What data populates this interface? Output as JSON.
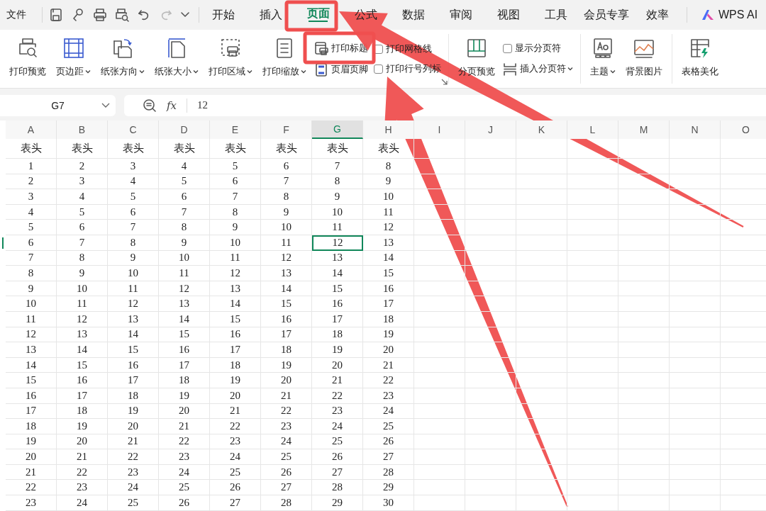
{
  "quick_access": {
    "file_menu": "文件",
    "redo_disabled": true
  },
  "tabs": [
    {
      "label": "开始",
      "selected": false
    },
    {
      "label": "插入",
      "selected": false
    },
    {
      "label": "页面",
      "selected": true
    },
    {
      "label": "公式",
      "selected": false
    },
    {
      "label": "数据",
      "selected": false
    },
    {
      "label": "审阅",
      "selected": false
    },
    {
      "label": "视图",
      "selected": false
    },
    {
      "label": "工具",
      "selected": false
    },
    {
      "label": "会员专享",
      "selected": false
    },
    {
      "label": "效率",
      "selected": false
    }
  ],
  "ai_button": "WPS AI",
  "ribbon": {
    "groups": [
      {
        "launcher": true,
        "columns": [
          [
            {
              "kind": "large",
              "label": "打印预览",
              "dropdown": false
            }
          ],
          [
            {
              "kind": "large",
              "label": "页边距",
              "dropdown": true
            }
          ],
          [
            {
              "kind": "large",
              "label": "纸张方向",
              "dropdown": true
            }
          ],
          [
            {
              "kind": "large",
              "label": "纸张大小",
              "dropdown": true
            }
          ],
          [
            {
              "kind": "large",
              "label": "打印区域",
              "dropdown": true
            }
          ],
          [
            {
              "kind": "large",
              "label": "打印缩放",
              "dropdown": true
            }
          ],
          [
            {
              "kind": "small",
              "label": "打印标题",
              "dropdown": false
            },
            {
              "kind": "small",
              "label": "页眉页脚",
              "dropdown": false
            }
          ],
          [
            {
              "kind": "check",
              "label": "打印网格线",
              "checked": false
            },
            {
              "kind": "check",
              "label": "打印行号列标",
              "checked": false
            }
          ]
        ]
      },
      {
        "launcher": false,
        "columns": [
          [
            {
              "kind": "large",
              "label": "分页预览",
              "dropdown": false
            }
          ],
          [
            {
              "kind": "check",
              "label": "显示分页符",
              "checked": false
            },
            {
              "kind": "small",
              "label": "插入分页符",
              "dropdown": true
            }
          ]
        ]
      },
      {
        "launcher": false,
        "columns": [
          [
            {
              "kind": "large",
              "label": "主题",
              "dropdown": true
            }
          ],
          [
            {
              "kind": "large",
              "label": "背景图片",
              "dropdown": false
            }
          ]
        ]
      },
      {
        "launcher": false,
        "columns": [
          [
            {
              "kind": "large",
              "label": "表格美化",
              "dropdown": false
            }
          ]
        ]
      }
    ]
  },
  "formula_bar": {
    "name_box": "G7",
    "function_label": "fx",
    "value": "12"
  },
  "sheet": {
    "columns": [
      {
        "label": "A",
        "selected": false
      },
      {
        "label": "B",
        "selected": false
      },
      {
        "label": "C",
        "selected": false
      },
      {
        "label": "D",
        "selected": false
      },
      {
        "label": "E",
        "selected": false
      },
      {
        "label": "F",
        "selected": false
      },
      {
        "label": "G",
        "selected": true
      },
      {
        "label": "H",
        "selected": false
      },
      {
        "label": "I",
        "selected": false
      },
      {
        "label": "J",
        "selected": false
      },
      {
        "label": "K",
        "selected": false
      },
      {
        "label": "L",
        "selected": false
      },
      {
        "label": "M",
        "selected": false
      },
      {
        "label": "N",
        "selected": false
      },
      {
        "label": "O",
        "selected": false
      }
    ],
    "rows": [
      {
        "selected": false,
        "cells": [
          "表头",
          "表头",
          "表头",
          "表头",
          "表头",
          "表头",
          "表头",
          "表头"
        ]
      },
      {
        "selected": false,
        "cells": [
          "1",
          "2",
          "3",
          "4",
          "5",
          "6",
          "7",
          "8"
        ]
      },
      {
        "selected": false,
        "cells": [
          "2",
          "3",
          "4",
          "5",
          "6",
          "7",
          "8",
          "9"
        ]
      },
      {
        "selected": false,
        "cells": [
          "3",
          "4",
          "5",
          "6",
          "7",
          "8",
          "9",
          "10"
        ]
      },
      {
        "selected": false,
        "cells": [
          "4",
          "5",
          "6",
          "7",
          "8",
          "9",
          "10",
          "11"
        ]
      },
      {
        "selected": false,
        "cells": [
          "5",
          "6",
          "7",
          "8",
          "9",
          "10",
          "11",
          "12"
        ]
      },
      {
        "selected": true,
        "cells": [
          "6",
          "7",
          "8",
          "9",
          "10",
          "11",
          "12",
          "13"
        ]
      },
      {
        "selected": false,
        "cells": [
          "7",
          "8",
          "9",
          "10",
          "11",
          "12",
          "13",
          "14"
        ]
      },
      {
        "selected": false,
        "cells": [
          "8",
          "9",
          "10",
          "11",
          "12",
          "13",
          "14",
          "15"
        ]
      },
      {
        "selected": false,
        "cells": [
          "9",
          "10",
          "11",
          "12",
          "13",
          "14",
          "15",
          "16"
        ]
      },
      {
        "selected": false,
        "cells": [
          "10",
          "11",
          "12",
          "13",
          "14",
          "15",
          "16",
          "17"
        ]
      },
      {
        "selected": false,
        "cells": [
          "11",
          "12",
          "13",
          "14",
          "15",
          "16",
          "17",
          "18"
        ]
      },
      {
        "selected": false,
        "cells": [
          "12",
          "13",
          "14",
          "15",
          "16",
          "17",
          "18",
          "19"
        ]
      },
      {
        "selected": false,
        "cells": [
          "13",
          "14",
          "15",
          "16",
          "17",
          "18",
          "19",
          "20"
        ]
      },
      {
        "selected": false,
        "cells": [
          "14",
          "15",
          "16",
          "17",
          "18",
          "19",
          "20",
          "21"
        ]
      },
      {
        "selected": false,
        "cells": [
          "15",
          "16",
          "17",
          "18",
          "19",
          "20",
          "21",
          "22"
        ]
      },
      {
        "selected": false,
        "cells": [
          "16",
          "17",
          "18",
          "19",
          "20",
          "21",
          "22",
          "23"
        ]
      },
      {
        "selected": false,
        "cells": [
          "17",
          "18",
          "19",
          "20",
          "21",
          "22",
          "23",
          "24"
        ]
      },
      {
        "selected": false,
        "cells": [
          "18",
          "19",
          "20",
          "21",
          "22",
          "23",
          "24",
          "25"
        ]
      },
      {
        "selected": false,
        "cells": [
          "19",
          "20",
          "21",
          "22",
          "23",
          "24",
          "25",
          "26"
        ]
      },
      {
        "selected": false,
        "cells": [
          "20",
          "21",
          "22",
          "23",
          "24",
          "25",
          "26",
          "27"
        ]
      },
      {
        "selected": false,
        "cells": [
          "21",
          "22",
          "23",
          "24",
          "25",
          "26",
          "27",
          "28"
        ]
      },
      {
        "selected": false,
        "cells": [
          "22",
          "23",
          "24",
          "25",
          "26",
          "27",
          "28",
          "29"
        ]
      },
      {
        "selected": false,
        "cells": [
          "23",
          "24",
          "25",
          "26",
          "27",
          "28",
          "29",
          "30"
        ]
      }
    ]
  },
  "annotations": [
    {
      "kind": "box"
    },
    {
      "kind": "box"
    },
    {
      "kind": "arrow"
    },
    {
      "kind": "arrow"
    }
  ]
}
